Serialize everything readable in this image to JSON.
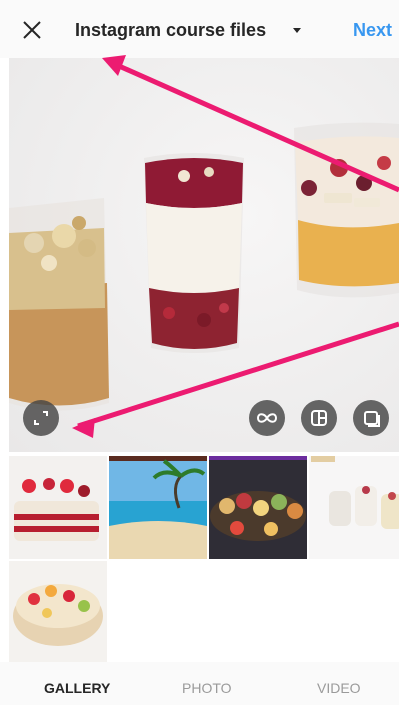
{
  "header": {
    "title": "Instagram course files",
    "next_label": "Next"
  },
  "icons": {
    "close": "close-icon",
    "dropdown": "caret-down-icon",
    "expand": "expand-icon",
    "boomerang": "infinity-icon",
    "layout": "layout-icon",
    "multiple": "multiple-select-icon"
  },
  "preview": {
    "subject": "three dessert glasses"
  },
  "gallery": {
    "items": [
      {
        "name": "strawberry layer cake"
      },
      {
        "name": "tropical beach"
      },
      {
        "name": "mini pastries"
      },
      {
        "name": "dessert glasses"
      },
      {
        "name": "fruit cake"
      }
    ]
  },
  "tabs": [
    {
      "label": "GALLERY",
      "active": true
    },
    {
      "label": "PHOTO",
      "active": false
    },
    {
      "label": "VIDEO",
      "active": false
    }
  ],
  "colors": {
    "accent": "#3897f0",
    "arrow": "#ec1b71"
  }
}
